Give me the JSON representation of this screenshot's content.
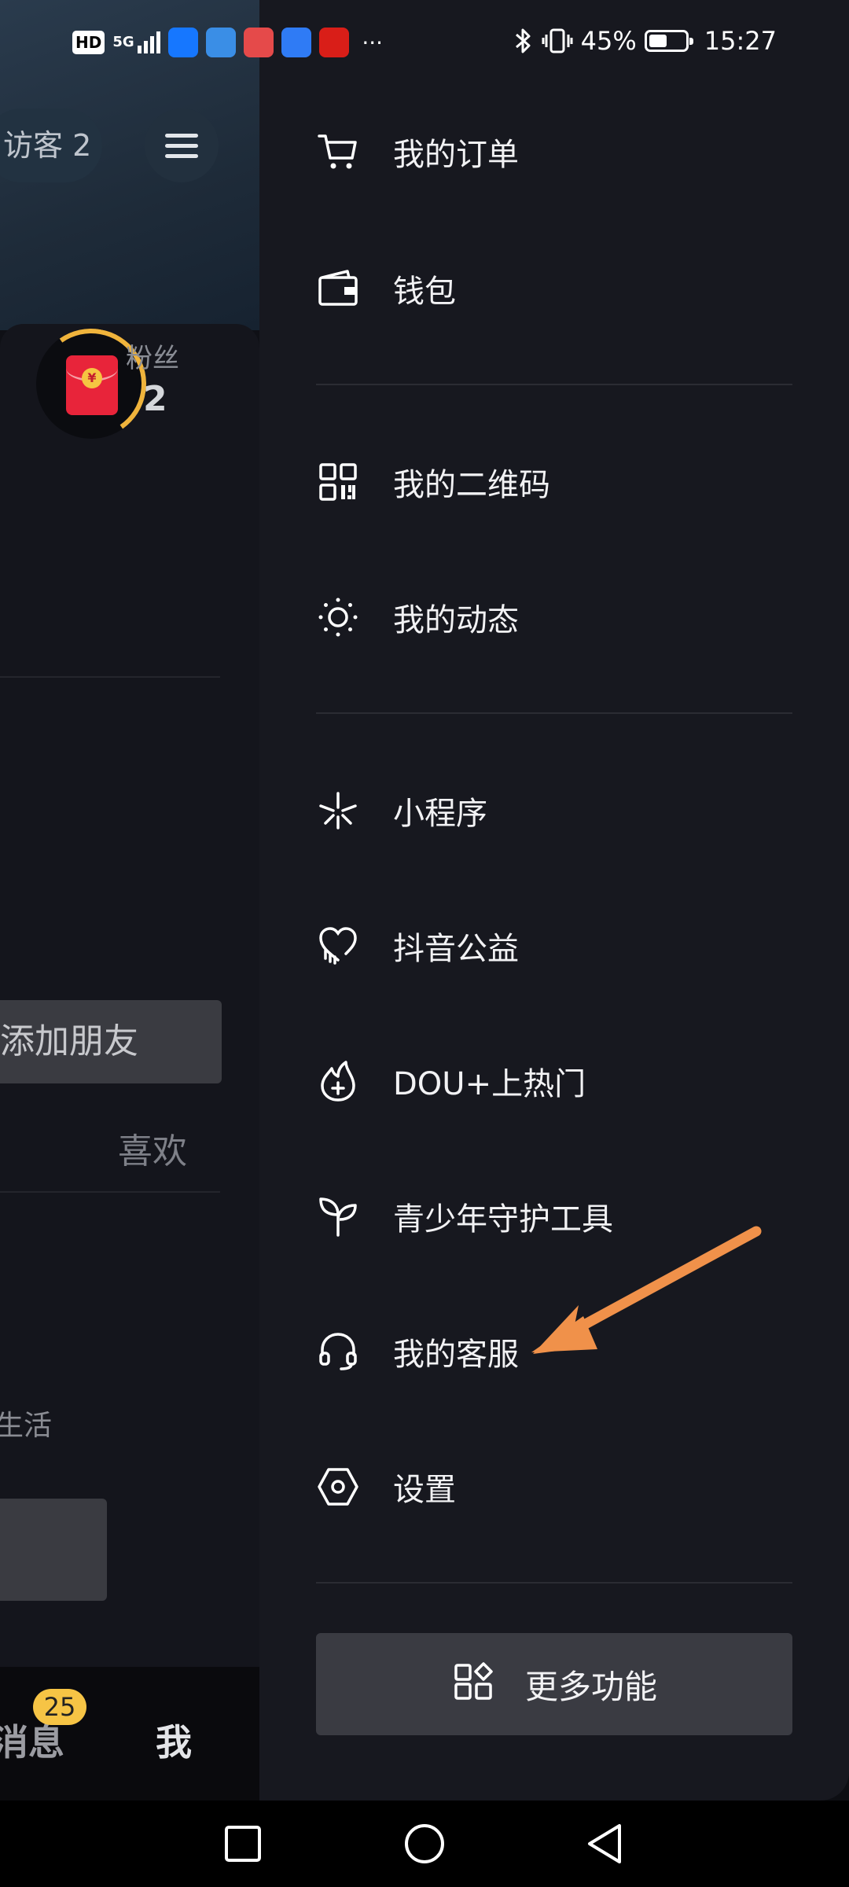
{
  "status_bar": {
    "hd_tag": "HD",
    "network": "5G",
    "battery_percent": "45%",
    "time": "15:27",
    "more_indicator": "···"
  },
  "background_profile": {
    "visitor_label": "访客 2",
    "fans_label": "粉丝",
    "fans_count": "2",
    "add_friend_label": "添加朋友",
    "likes_tab": "喜欢",
    "life_text": "生活",
    "bottom_nav": {
      "messages_label": "消息",
      "messages_badge": "25",
      "me_label": "我"
    }
  },
  "drawer": {
    "items": [
      {
        "label": "我的订单",
        "icon": "cart-icon"
      },
      {
        "label": "钱包",
        "icon": "wallet-icon"
      },
      {
        "label": "我的二维码",
        "icon": "qr-code-icon"
      },
      {
        "label": "我的动态",
        "icon": "sun-activity-icon"
      },
      {
        "label": "小程序",
        "icon": "mini-program-icon"
      },
      {
        "label": "抖音公益",
        "icon": "charity-heart-icon"
      },
      {
        "label": "DOU+上热门",
        "icon": "flame-plus-icon"
      },
      {
        "label": "青少年守护工具",
        "icon": "sprout-icon"
      },
      {
        "label": "我的客服",
        "icon": "headset-icon"
      },
      {
        "label": "设置",
        "icon": "settings-hex-icon"
      }
    ],
    "more_button_label": "更多功能"
  },
  "colors": {
    "drawer_bg": "#17181f",
    "annotation_arrow": "#f0914a",
    "badge": "#f6c445"
  }
}
